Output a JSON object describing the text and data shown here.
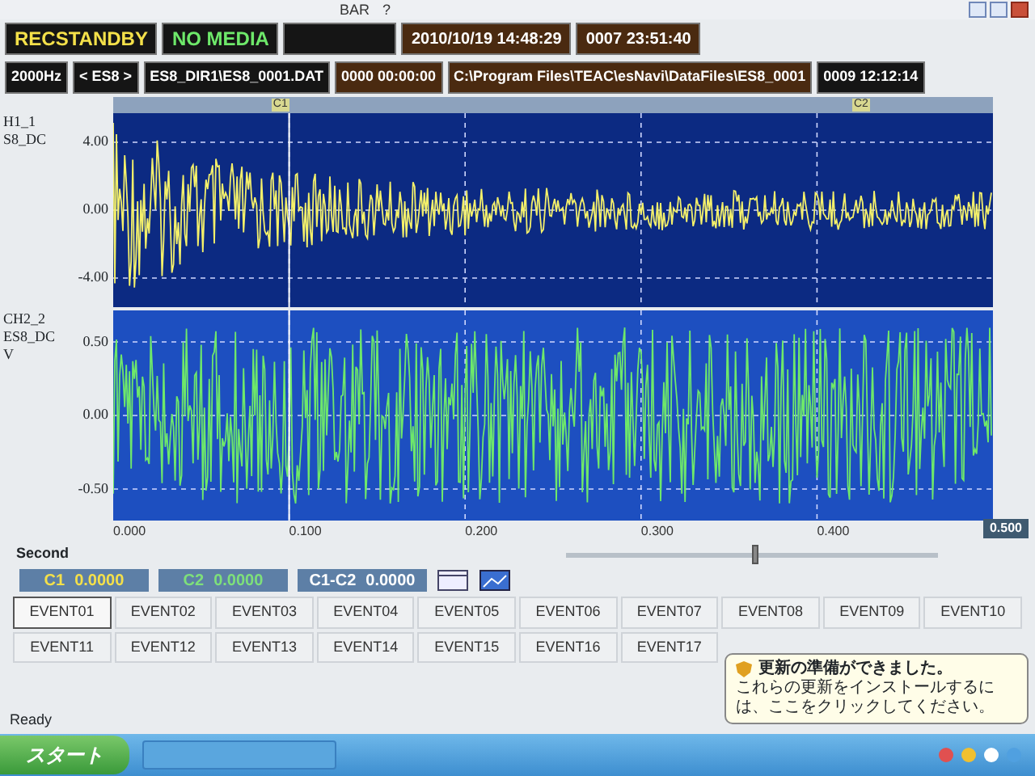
{
  "toolbar": {
    "items": [
      "BAR",
      "?"
    ]
  },
  "display_row_1": [
    {
      "kind": "state",
      "text": "RECSTANDBY"
    },
    {
      "kind": "media",
      "text": "NO MEDIA"
    },
    {
      "kind": "empty"
    },
    {
      "kind": "clock",
      "text": "2010/10/19 14:48:29"
    },
    {
      "kind": "clock",
      "text": "0007 23:51:40"
    }
  ],
  "display_row_2": [
    {
      "kind": "plain",
      "text": "2000Hz"
    },
    {
      "kind": "plain",
      "text": "< ES8 >"
    },
    {
      "kind": "plain",
      "text": "ES8_DIR1\\ES8_0001.DAT"
    },
    {
      "kind": "clock",
      "text": "0000 00:00:00"
    },
    {
      "kind": "clock",
      "text": "C:\\Program Files\\TEAC\\esNavi\\DataFiles\\ES8_0001"
    },
    {
      "kind": "plain",
      "text": "0009 12:12:14"
    }
  ],
  "cursors": [
    {
      "label": "C1"
    },
    {
      "label": "C2"
    }
  ],
  "channels": [
    {
      "labels": [
        "H1_1",
        "S8_DC"
      ],
      "ticks": [
        "4.00",
        "0.00",
        "-4.00"
      ],
      "color": "#f4f06a"
    },
    {
      "labels": [
        "CH2_2",
        "ES8_DC",
        "V"
      ],
      "ticks": [
        "0.50",
        "0.00",
        "-0.50"
      ],
      "color": "#6ee86a"
    }
  ],
  "x_axis": {
    "title": "Second",
    "ticks": [
      "0.000",
      "0.100",
      "0.200",
      "0.300",
      "0.400"
    ],
    "end_value": "0.500"
  },
  "zoom_slider": {
    "level": 0.5
  },
  "readouts": [
    {
      "label": "C1",
      "value": "0.0000",
      "kind": "first"
    },
    {
      "label": "C2",
      "value": "0.0000",
      "kind": "second"
    },
    {
      "label": "C1-C2",
      "value": "0.0000",
      "kind": "difference"
    }
  ],
  "events": [
    {
      "label": "EVENT01",
      "selected": true
    },
    {
      "label": "EVENT02",
      "selected": false
    },
    {
      "label": "EVENT03",
      "selected": false
    },
    {
      "label": "EVENT04",
      "selected": false
    },
    {
      "label": "EVENT05",
      "selected": false
    },
    {
      "label": "EVENT06",
      "selected": false
    },
    {
      "label": "EVENT07",
      "selected": false
    },
    {
      "label": "EVENT08",
      "selected": false
    },
    {
      "label": "EVENT09",
      "selected": false
    },
    {
      "label": "EVENT10",
      "selected": false
    },
    {
      "label": "EVENT11",
      "selected": false
    },
    {
      "label": "EVENT12",
      "selected": false
    },
    {
      "label": "EVENT13",
      "selected": false
    },
    {
      "label": "EVENT14",
      "selected": false
    },
    {
      "label": "EVENT15",
      "selected": false
    },
    {
      "label": "EVENT16",
      "selected": false
    },
    {
      "label": "EVENT17",
      "selected": false
    }
  ],
  "notification": {
    "title": "更新の準備ができました。",
    "body": "これらの更新をインストールするには、ここをクリックしてください。"
  },
  "status_bar": {
    "text": "Ready"
  },
  "taskbar": {
    "start": "スタート"
  }
}
